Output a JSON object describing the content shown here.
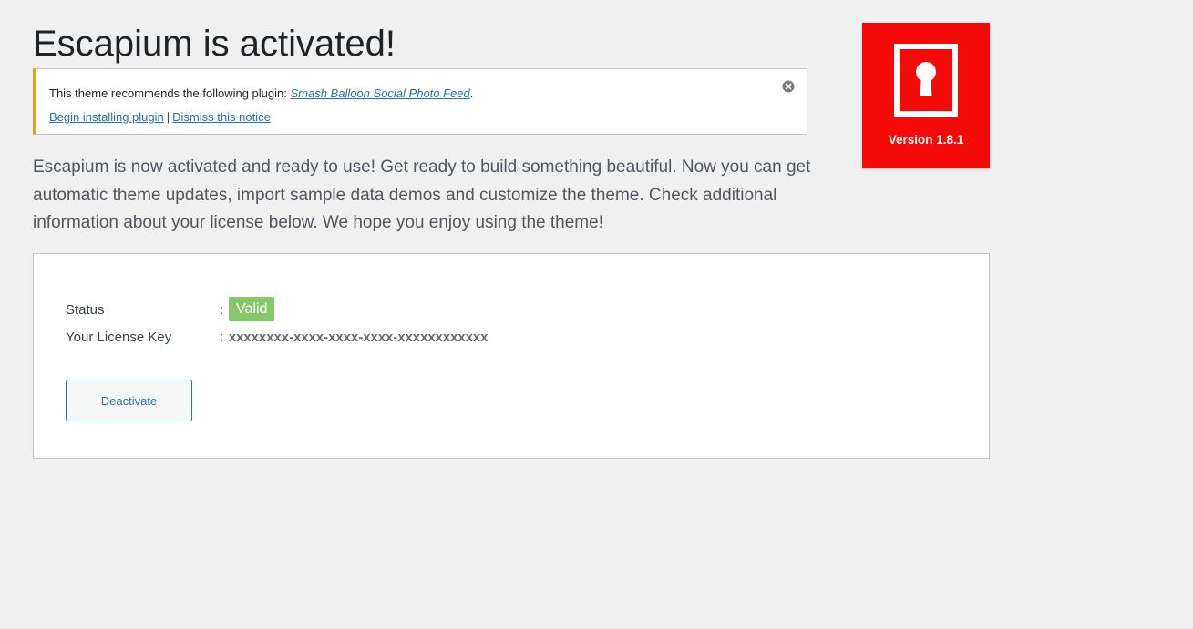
{
  "header": {
    "title": "Escapium is activated!"
  },
  "notice": {
    "text_prefix": "This theme recommends the following plugin: ",
    "plugin_name": "Smash Balloon Social Photo Feed",
    "text_suffix": ".",
    "begin_install_label": "Begin installing plugin",
    "separator": "|",
    "dismiss_label": "Dismiss this notice",
    "close_icon": "close-circle-icon"
  },
  "intro": {
    "text": "Escapium is now activated and ready to use! Get ready to build something beautiful. Now you can get automatic theme updates, import sample data demos and customize the theme. Check additional information about your license below. We hope you enjoy using the theme!"
  },
  "badge": {
    "logo_icon": "keyhole-door-icon",
    "version": "Version 1.8.1",
    "color": "#f50a0a"
  },
  "license": {
    "status_label": "Status",
    "status_colon": ":",
    "status_value": "Valid",
    "status_color": "#86c76a",
    "key_label": "Your License Key",
    "key_colon": ":",
    "key_value": "xxxxxxxx-xxxx-xxxx-xxxx-xxxxxxxxxxxx",
    "deactivate_label": "Deactivate"
  }
}
